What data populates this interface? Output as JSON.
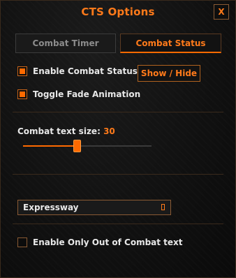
{
  "window": {
    "title": "CTS Options",
    "close_label": "X"
  },
  "tabs": [
    {
      "label": "Combat Timer",
      "active": false
    },
    {
      "label": "Combat Status",
      "active": true
    }
  ],
  "options": {
    "enable_combat_status": {
      "label": "Enable Combat Status",
      "checked": true
    },
    "toggle_fade": {
      "label": "Toggle Fade Animation",
      "checked": true
    },
    "show_hide_label": "Show / Hide",
    "text_size": {
      "label": "Combat text size:",
      "value": "30",
      "slider_fraction": 0.42
    },
    "font_select": {
      "value": "Expressway"
    },
    "only_out_of_combat": {
      "label": "Enable Only Out of Combat text",
      "checked": false
    }
  },
  "colors": {
    "accent": "#ff6a00",
    "accent_text": "#ff7a1a",
    "text": "#e8e8e8",
    "muted_text": "#8c8c8c",
    "background": "#111111"
  }
}
